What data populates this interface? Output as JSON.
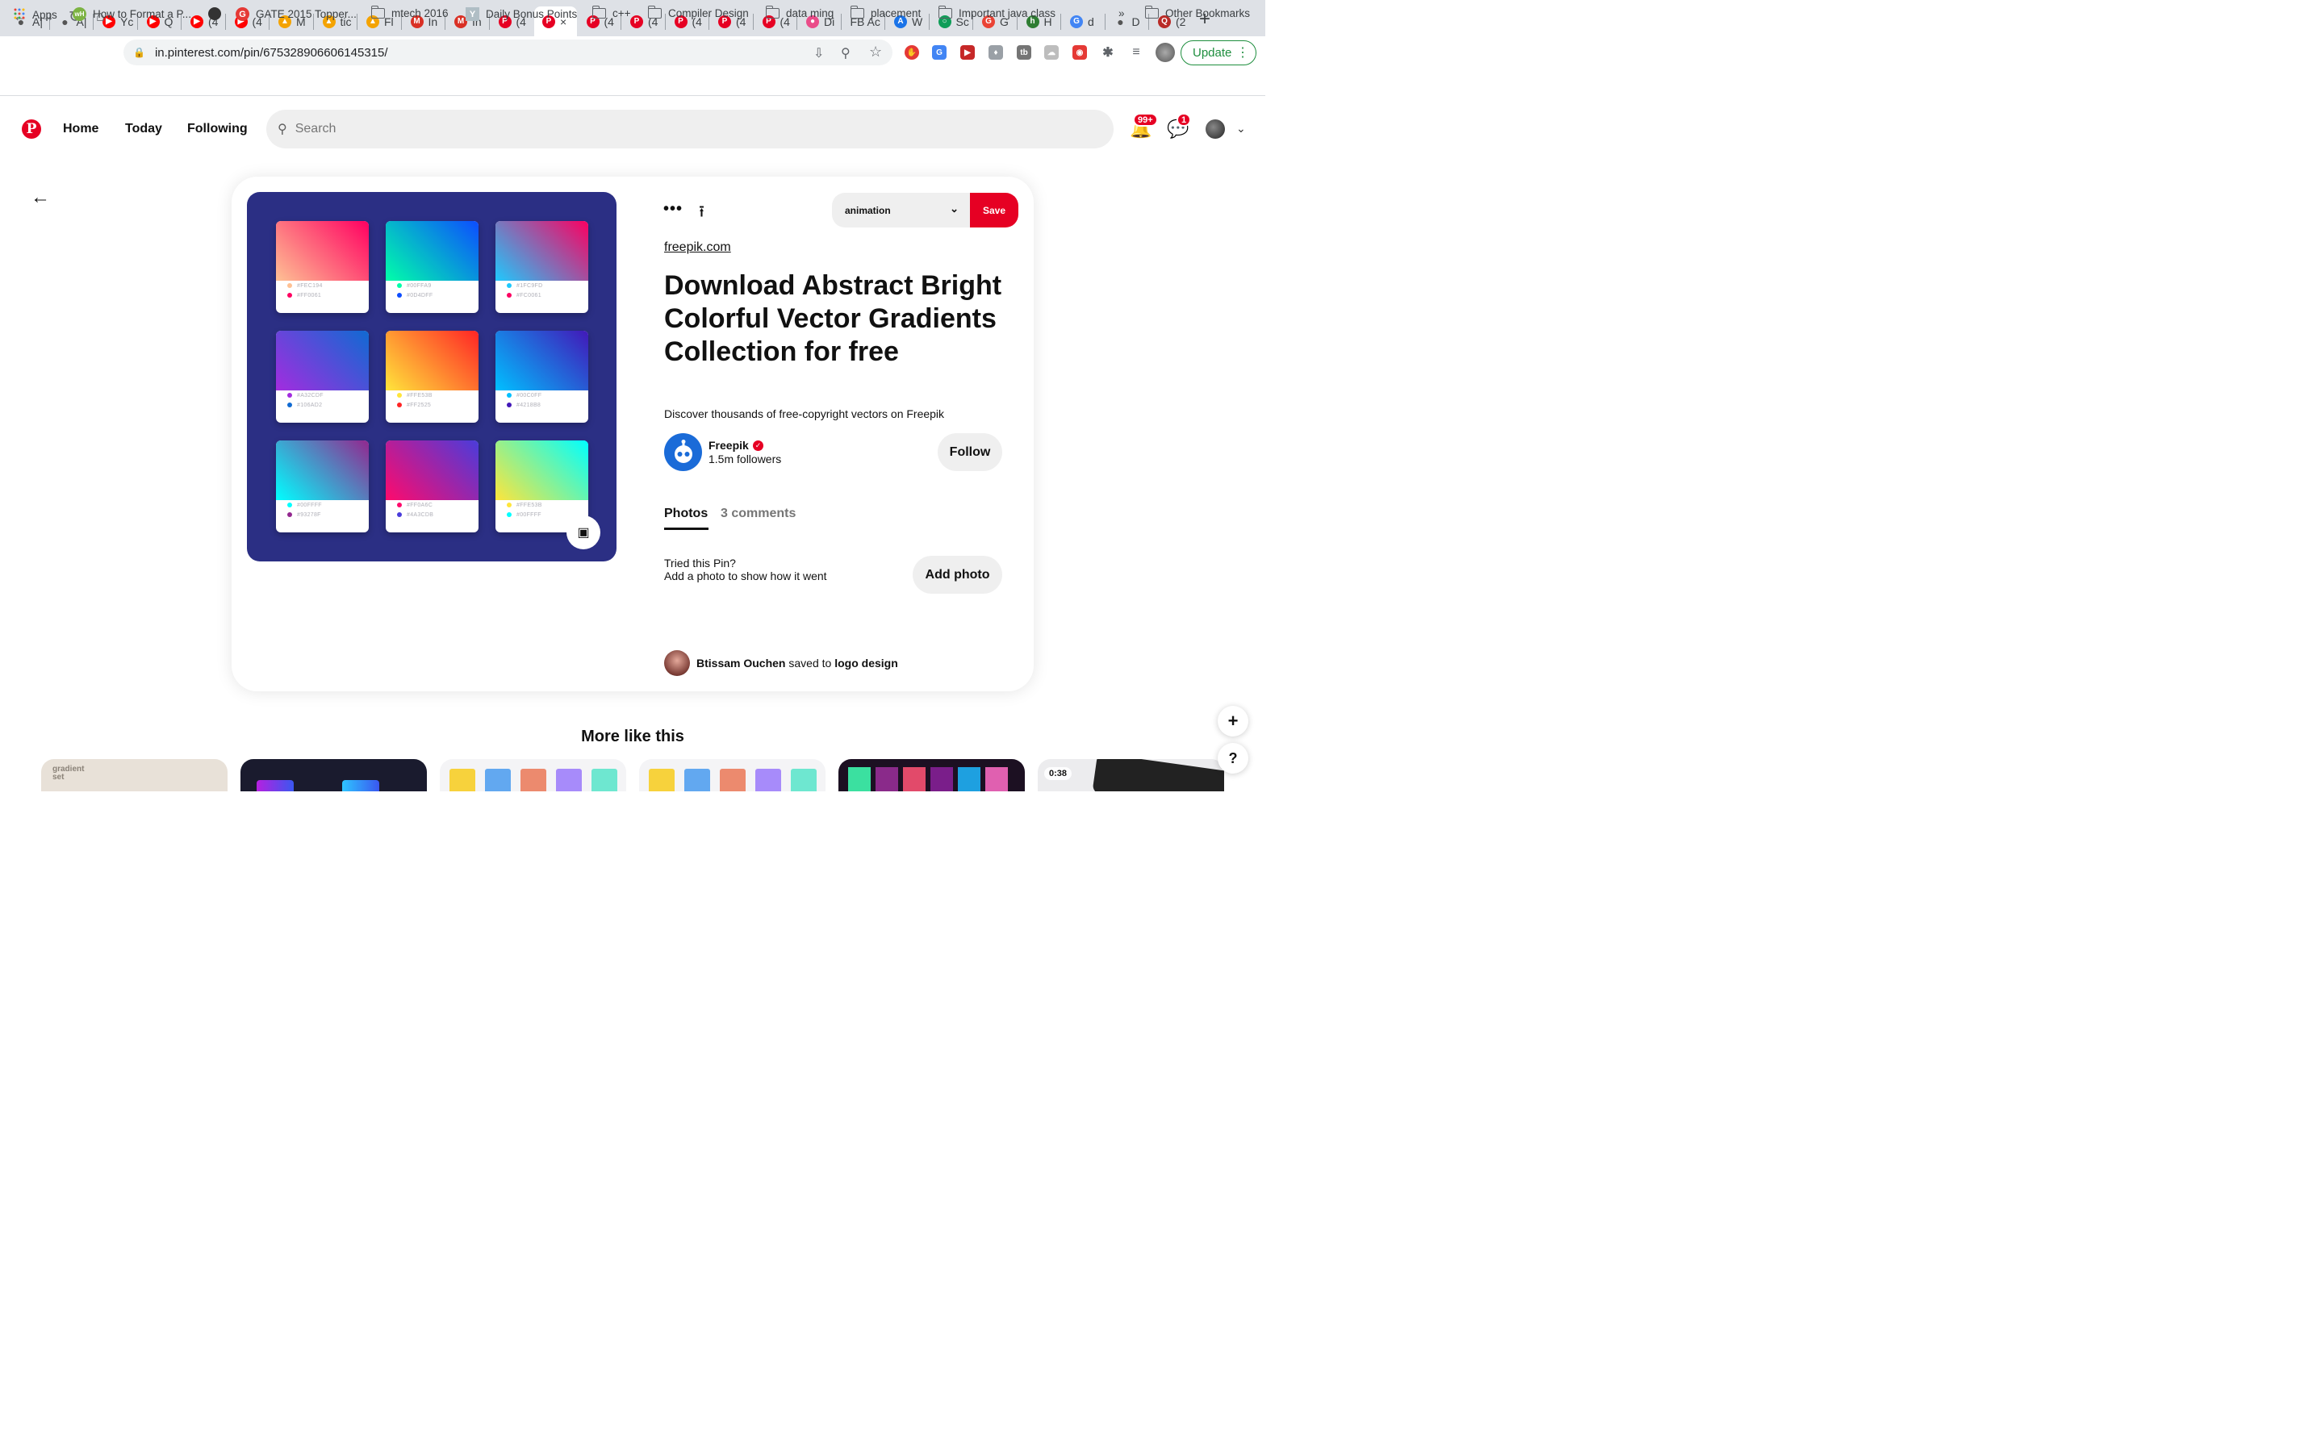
{
  "browser": {
    "tabs": [
      {
        "label": "A|",
        "icon": "apple-icon",
        "color": "#555555"
      },
      {
        "label": "A|",
        "icon": "apple-icon",
        "color": "#555555"
      },
      {
        "label": "Yc",
        "icon": "youtube-icon",
        "color": "#ff0000"
      },
      {
        "label": "Q",
        "icon": "youtube-icon",
        "color": "#ff0000"
      },
      {
        "label": "(4",
        "icon": "youtube-icon",
        "color": "#ff0000"
      },
      {
        "label": "(4",
        "icon": "youtube-icon",
        "color": "#ff0000"
      },
      {
        "label": "M",
        "icon": "flame-icon",
        "color": "#f4a300"
      },
      {
        "label": "tic",
        "icon": "flame-icon",
        "color": "#f4a300"
      },
      {
        "label": "Fl",
        "icon": "flame-icon",
        "color": "#f4a300"
      },
      {
        "label": "In",
        "icon": "gmail-icon",
        "color": "#d93025"
      },
      {
        "label": "In",
        "icon": "gmail-icon",
        "color": "#d93025"
      },
      {
        "label": "(4",
        "icon": "pinterest-icon",
        "color": "#e60023"
      },
      {
        "label": "×",
        "icon": "pinterest-icon",
        "color": "#e60023",
        "active": true
      },
      {
        "label": "(4",
        "icon": "pinterest-icon",
        "color": "#e60023"
      },
      {
        "label": "(4",
        "icon": "pinterest-icon",
        "color": "#e60023"
      },
      {
        "label": "(4",
        "icon": "pinterest-icon",
        "color": "#e60023"
      },
      {
        "label": "(4",
        "icon": "pinterest-icon",
        "color": "#e60023"
      },
      {
        "label": "(4",
        "icon": "pinterest-icon",
        "color": "#e60023"
      },
      {
        "label": "Di",
        "icon": "dribbble-icon",
        "color": "#ea4c89"
      },
      {
        "label": "FB Ac",
        "icon": "none",
        "color": "#3c4043"
      },
      {
        "label": "W",
        "icon": "appstore-icon",
        "color": "#1a73e8"
      },
      {
        "label": "Sc",
        "icon": "circle-icon",
        "color": "#0f9d58"
      },
      {
        "label": "G",
        "icon": "google-color-icon",
        "color": "#ea4335"
      },
      {
        "label": "H",
        "icon": "h-icon",
        "color": "#2e7d32"
      },
      {
        "label": "d",
        "icon": "google-icon",
        "color": "#4285f4"
      },
      {
        "label": "D",
        "icon": "apple-icon",
        "color": "#555555"
      },
      {
        "label": "(2",
        "icon": "quora-icon",
        "color": "#b92b27"
      }
    ],
    "url": "in.pinterest.com/pin/675328906606145315/",
    "update_label": "Update",
    "bookmarks": [
      {
        "label": "Apps",
        "icon": "apps-grid-icon"
      },
      {
        "label": "How to Format a P...",
        "icon": "wh-icon"
      },
      {
        "label": "",
        "icon": "globe-icon"
      },
      {
        "label": "GATE 2015 Topper...",
        "icon": "g-red-icon"
      },
      {
        "label": "mtech 2016",
        "icon": "folder-icon"
      },
      {
        "label": "Daily Bonus Points",
        "icon": "y-icon"
      },
      {
        "label": "c++",
        "icon": "folder-icon"
      },
      {
        "label": "Compiler Design",
        "icon": "folder-icon"
      },
      {
        "label": "data ming",
        "icon": "folder-icon"
      },
      {
        "label": "placement",
        "icon": "folder-icon"
      },
      {
        "label": "Important java class",
        "icon": "folder-icon"
      }
    ],
    "overflow_label": "»",
    "other_bookmarks": "Other Bookmarks"
  },
  "header": {
    "nav": [
      "Home",
      "Today",
      "Following"
    ],
    "search_placeholder": "Search",
    "notifications_badge": "99+",
    "messages_badge": "1"
  },
  "pin": {
    "swatches": [
      {
        "c1": "#FEC194",
        "c2": "#FF0061",
        "l1": "#FEC194",
        "l2": "#FF0061"
      },
      {
        "c1": "#00FFA9",
        "c2": "#0D4DFF",
        "l1": "#00FFA9",
        "l2": "#0D4DFF"
      },
      {
        "c1": "#1FC9FD",
        "c2": "#FC0061",
        "l1": "#1FC9FD",
        "l2": "#FC0061"
      },
      {
        "c1": "#A32CDF",
        "c2": "#106AD2",
        "l1": "#A32CDF",
        "l2": "#106AD2"
      },
      {
        "c1": "#FFE53B",
        "c2": "#FF2525",
        "l1": "#FFE53B",
        "l2": "#FF2525"
      },
      {
        "c1": "#00C0FF",
        "c2": "#4218B8",
        "l1": "#00C0FF",
        "l2": "#4218B8"
      },
      {
        "c1": "#00FFFF",
        "c2": "#93278F",
        "l1": "#00FFFF",
        "l2": "#93278F"
      },
      {
        "c1": "#FF0A6C",
        "c2": "#4A3CDB",
        "l1": "#FF0A6C",
        "l2": "#4A3CDB"
      },
      {
        "c1": "#FFE53B",
        "c2": "#00FFFF",
        "l1": "#FFE53B",
        "l2": "#00FFFF"
      }
    ],
    "board": "animation",
    "save_label": "Save",
    "source": "freepik.com",
    "title": "Download Abstract Bright Colorful Vector Gradients Collection for free",
    "description": "Discover thousands of free-copyright vectors on Freepik",
    "creator": {
      "name": "Freepik",
      "followers": "1.5m followers"
    },
    "follow_label": "Follow",
    "tabs": {
      "photos": "Photos",
      "comments": "3 comments"
    },
    "tried_title": "Tried this Pin?",
    "tried_sub": "Add a photo to show how it went",
    "add_photo_label": "Add photo",
    "saved_by": {
      "user": "Btissam Ouchen",
      "mid": "saved to",
      "board": "logo design"
    }
  },
  "more_like_this": {
    "title": "More like this",
    "thumbs": [
      {
        "caption": "gradient set",
        "bg": "#e8e1d8"
      },
      {
        "caption": "",
        "bg": "#1a1b2e"
      },
      {
        "caption": "",
        "bg": "#f4f4f6"
      },
      {
        "caption": "",
        "bg": "#f4f4f6"
      },
      {
        "caption": "",
        "bg": "#1c1022"
      },
      {
        "caption": "0:38",
        "bg": "#ececee"
      }
    ]
  },
  "fab": {
    "plus": "+",
    "help": "?"
  }
}
